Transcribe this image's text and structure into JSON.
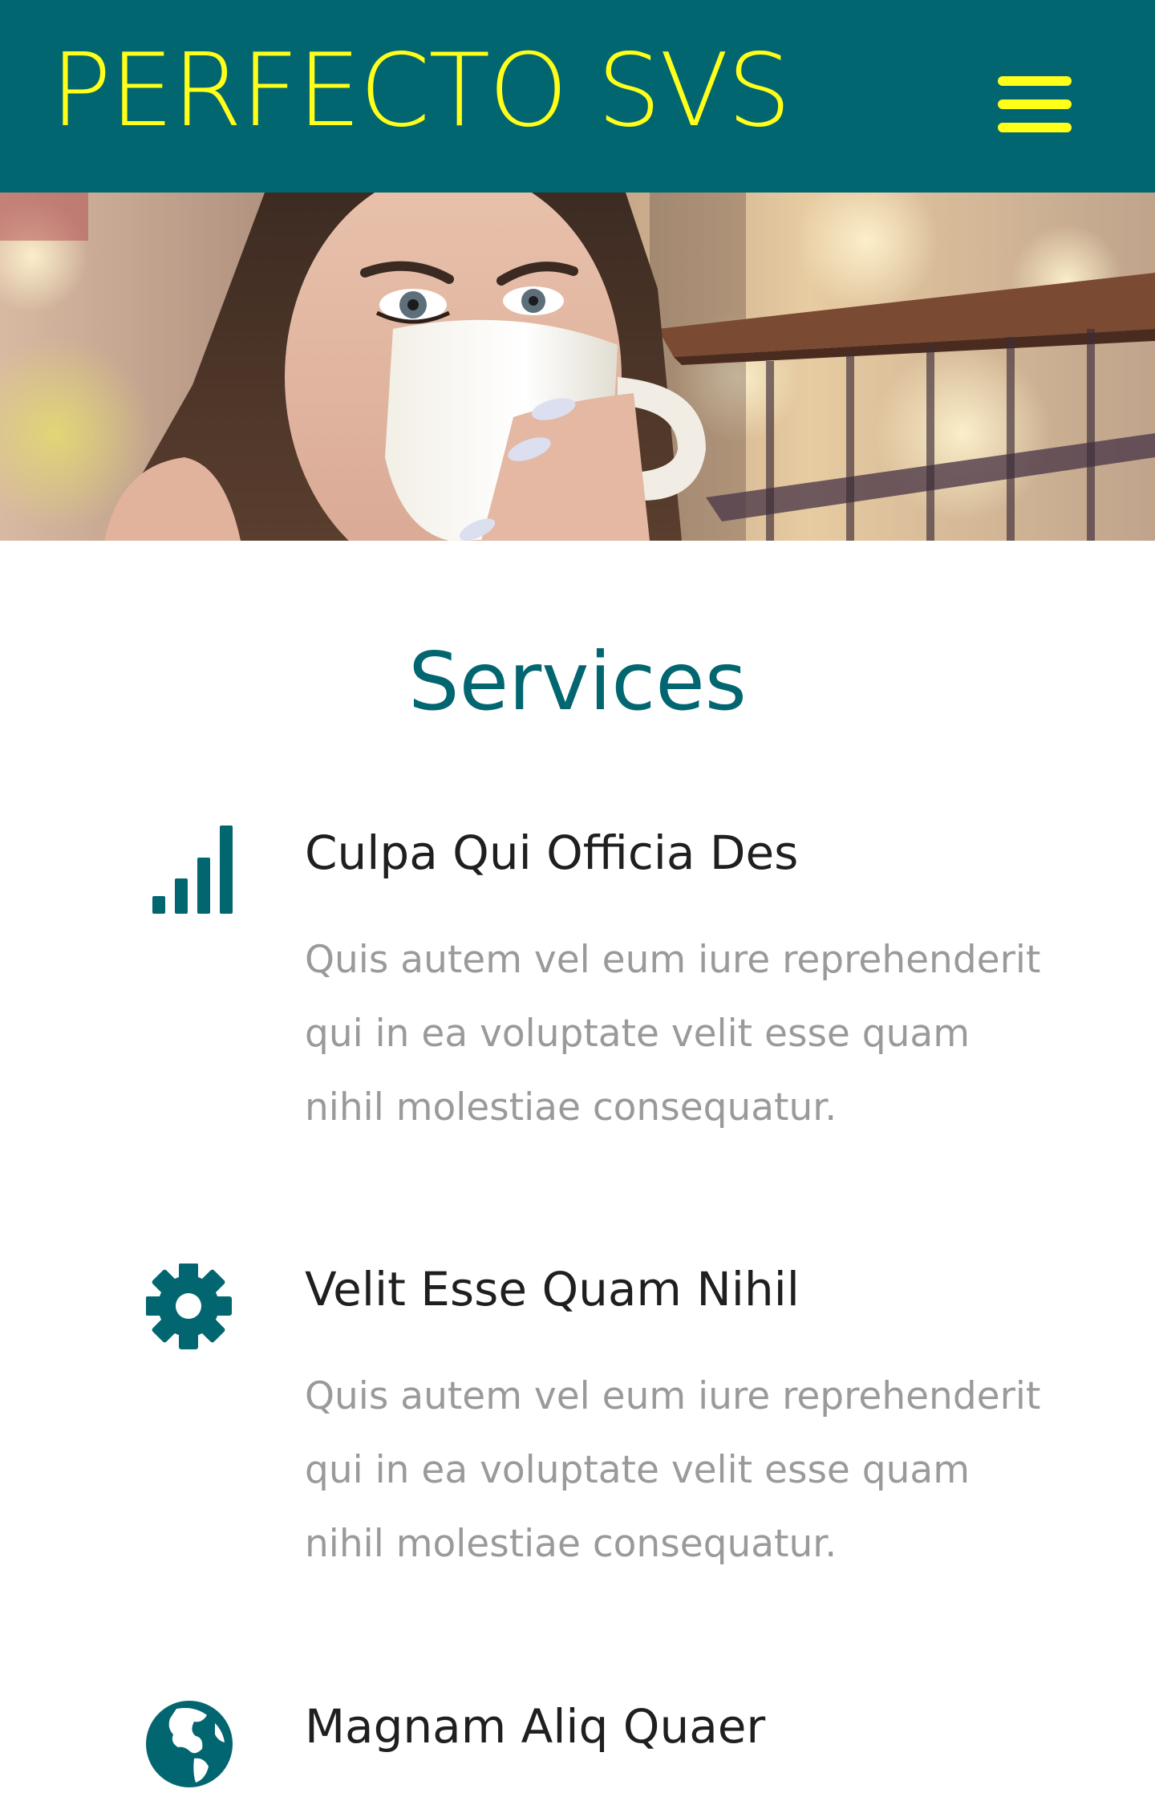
{
  "header": {
    "brand": "PERFECTO SVS",
    "menu_icon": "hamburger-menu-icon"
  },
  "colors": {
    "primary": "#026670",
    "accent": "#ffff1a",
    "heading_text": "#1f1f1f",
    "body_text": "#9a9a9a"
  },
  "services": {
    "title": "Services",
    "items": [
      {
        "icon": "signal-bars-icon",
        "title": "Culpa Qui Officia Des",
        "desc": "Quis autem vel eum iure reprehenderit qui in ea voluptate velit esse quam nihil molestiae consequatur."
      },
      {
        "icon": "gear-icon",
        "title": "Velit Esse Quam Nihil",
        "desc": "Quis autem vel eum iure reprehenderit qui in ea voluptate velit esse quam nihil molestiae consequatur."
      },
      {
        "icon": "globe-icon",
        "title": "Magnam Aliq Quaer",
        "desc": ""
      }
    ]
  }
}
